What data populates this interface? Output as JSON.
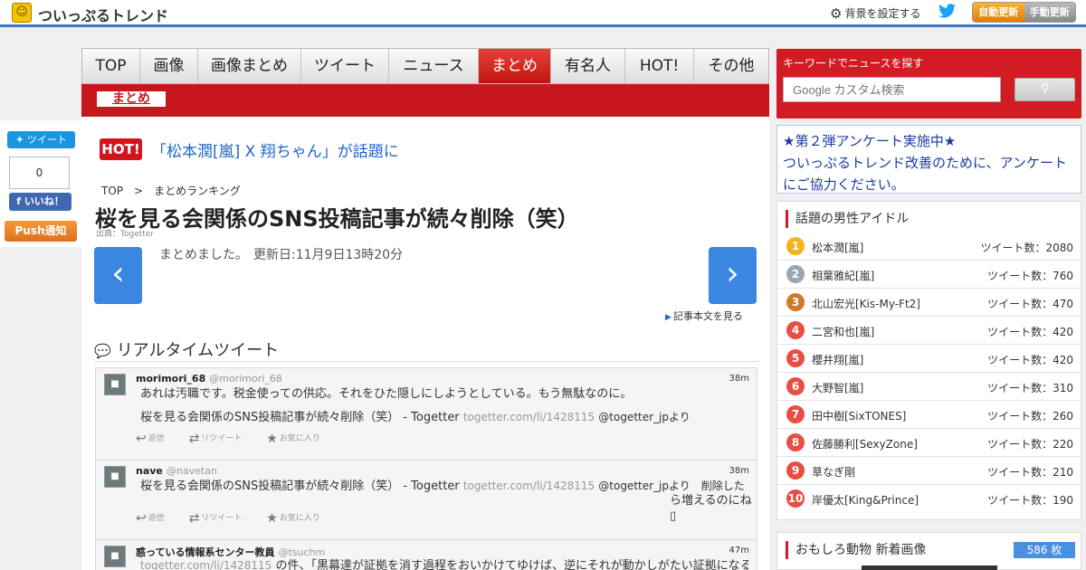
{
  "header": {
    "site_title": "ついっぷるトレンド",
    "bg_setting": "背景を設定する",
    "auto_update": "自動更新",
    "manual_update": "手動更新"
  },
  "share": {
    "tweet_label": "ツイート",
    "count": "0",
    "like_label": "いいね！",
    "push_label": "Push通知"
  },
  "nav": {
    "tabs": [
      "TOP",
      "画像",
      "画像まとめ",
      "ツイート",
      "ニュース",
      "まとめ",
      "有名人",
      "HOT!",
      "その他"
    ],
    "active": "まとめ",
    "sub_active": "まとめ"
  },
  "article": {
    "hot_badge": "HOT!",
    "hot_text": "「松本潤[嵐] X 翔ちゃん」が話題に",
    "breadcrumb": [
      "TOP",
      "まとめランキング"
    ],
    "breadcrumb_sep": ">",
    "title": "桜を見る会関係のSNS投稿記事が続々削除（笑）",
    "source": "出典：Togetter",
    "summary": "まとめました。",
    "updated": "更新日:11月9日13時20分",
    "more_link": "記事本文を見る"
  },
  "realtime": {
    "heading": "リアルタイムツイート",
    "reply_label": "返信",
    "retweet_label": "リツイート",
    "fav_label": "お気に入り",
    "tweets": [
      {
        "user": "morimori_68",
        "handle": "@morimori_68",
        "time": "38m",
        "line1": "あれは汚職です。税金使っての供応。それをひた隠しにしようとしている。もう無駄なのに。",
        "line2": "桜を見る会関係のSNS投稿記事が続々削除（笑） - Togetter",
        "link": "togetter.com/li/1428115",
        "via": "@togetter_jpより"
      },
      {
        "user": "nave",
        "handle": "@navetan",
        "time": "38m",
        "line1": "桜を見る会関係のSNS投稿記事が続々削除（笑） - Togetter",
        "link": "togetter.com/li/1428115",
        "via": "@togetter_jpより　削除した",
        "line2": "ら増えるのにね▯"
      },
      {
        "user": "惑っている情報系センター教員",
        "handle": "@tsuchm",
        "time": "47m",
        "link": "togetter.com/li/1428115",
        "line1": "の件、「黒幕達が証拠を消す過程をおいかけてゆけば、逆にそれが動かしがたい証拠になる」calil.j"
      }
    ]
  },
  "search": {
    "label": "キーワードでニュースを探す",
    "placeholder": "Google カスタム検索"
  },
  "survey": {
    "line1": "★第２弾アンケート実施中★",
    "line2": "ついっぷるトレンド改善のために、アンケートにご協力ください。"
  },
  "ranking": {
    "title": "話題の男性アイドル",
    "count_prefix": "ツイート数：",
    "rows": [
      {
        "rank": "1",
        "name": "松本潤[嵐]",
        "count": "2080"
      },
      {
        "rank": "2",
        "name": "相葉雅紀[嵐]",
        "count": "760"
      },
      {
        "rank": "3",
        "name": "北山宏光[Kis-My-Ft2]",
        "count": "470"
      },
      {
        "rank": "4",
        "name": "二宮和也[嵐]",
        "count": "420"
      },
      {
        "rank": "5",
        "name": "櫻井翔[嵐]",
        "count": "420"
      },
      {
        "rank": "6",
        "name": "大野智[嵐]",
        "count": "310"
      },
      {
        "rank": "7",
        "name": "田中樹[SixTONES]",
        "count": "260"
      },
      {
        "rank": "8",
        "name": "佐藤勝利[SexyZone]",
        "count": "220"
      },
      {
        "rank": "9",
        "name": "草なぎ剛",
        "count": "210"
      },
      {
        "rank": "10",
        "name": "岸優太[King&Prince]",
        "count": "190"
      }
    ]
  },
  "animal": {
    "title": "おもしろ動物 新着画像",
    "count": "586 枚"
  },
  "icons": {
    "logo": "logo-icon",
    "gear": "gear-icon",
    "twitter": "twitter-bird-icon",
    "chat": "chat-bubbles-icon",
    "reply": "reply-icon",
    "retweet": "retweet-icon",
    "star": "star-icon",
    "search": "search-icon"
  },
  "colors": {
    "accent_red": "#c8171c",
    "link_blue": "#1a66cc",
    "header_blue": "#3c7bc4",
    "nav_blue": "#3a86e0"
  }
}
